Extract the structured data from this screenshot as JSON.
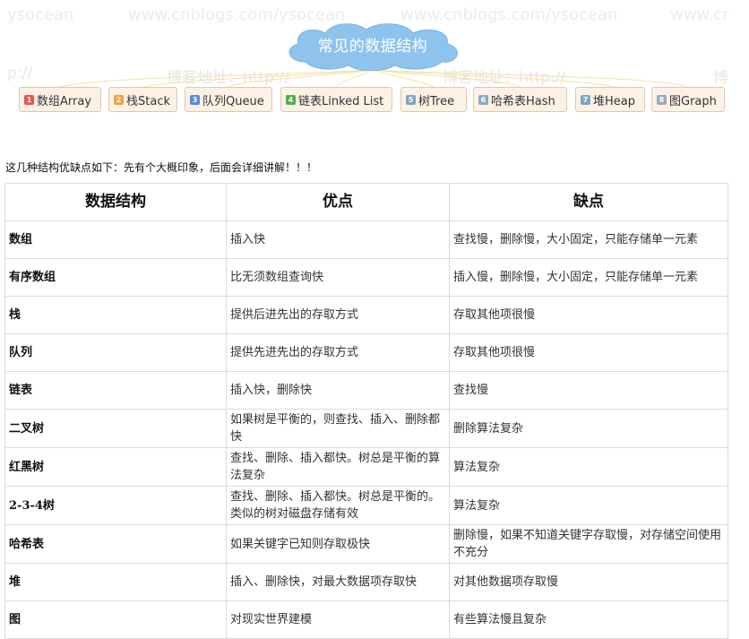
{
  "watermarks": {
    "top_left": "ysocean",
    "top_mid1": "www.cnblogs.com/ysocean",
    "top_mid2": "www.cnblogs.com/ysocean",
    "top_right": "www.cr",
    "second_left": "p://",
    "second_mid1": "博客地址：http://",
    "second_mid2": "博客地址：http://",
    "second_right": "博"
  },
  "mindmap": {
    "center_title": "常见的数据结构",
    "center_color": "#8ec3ee",
    "topics": [
      {
        "num": "1",
        "label": "数组Array",
        "badge_color": "#e8554e"
      },
      {
        "num": "2",
        "label": "栈Stack",
        "badge_color": "#f2a43a"
      },
      {
        "num": "3",
        "label": "队列Queue",
        "badge_color": "#5b8bd6"
      },
      {
        "num": "4",
        "label": "链表Linked List",
        "badge_color": "#4cb34c"
      },
      {
        "num": "5",
        "label": "树Tree",
        "badge_color": "#7fa6c4"
      },
      {
        "num": "6",
        "label": "哈希表Hash",
        "badge_color": "#8aa8c0"
      },
      {
        "num": "7",
        "label": "堆Heap",
        "badge_color": "#7fa6c4"
      },
      {
        "num": "8",
        "label": "图Graph",
        "badge_color": "#9aaabb"
      }
    ]
  },
  "intro_text": "这几种结构优缺点如下：先有个大概印象，后面会详细讲解！！！",
  "table": {
    "headers": [
      "数据结构",
      "优点",
      "缺点"
    ],
    "rows": [
      [
        "数组",
        "插入快",
        "查找慢，删除慢，大小固定，只能存储单一元素"
      ],
      [
        "有序数组",
        "比无须数组查询快",
        "插入慢，删除慢，大小固定，只能存储单一元素"
      ],
      [
        "栈",
        "提供后进先出的存取方式",
        "存取其他项很慢"
      ],
      [
        "队列",
        "提供先进先出的存取方式",
        "存取其他项很慢"
      ],
      [
        "链表",
        "插入快，删除快",
        "查找慢"
      ],
      [
        "二叉树",
        "如果树是平衡的，则查找、插入、删除都快",
        "删除算法复杂"
      ],
      [
        "红黑树",
        "查找、删除、插入都快。树总是平衡的算法复杂",
        "算法复杂"
      ],
      [
        "2-3-4树",
        "查找、删除、插入都快。树总是平衡的。类似的树对磁盘存储有效",
        "算法复杂"
      ],
      [
        "哈希表",
        "如果关键字已知则存取极快",
        "删除慢，如果不知道关键字存取慢，对存储空间使用不充分"
      ],
      [
        "堆",
        "插入、删除快，对最大数据项存取快",
        "对其他数据项存取慢"
      ],
      [
        "图",
        "对现实世界建模",
        "有些算法慢且复杂"
      ]
    ]
  }
}
